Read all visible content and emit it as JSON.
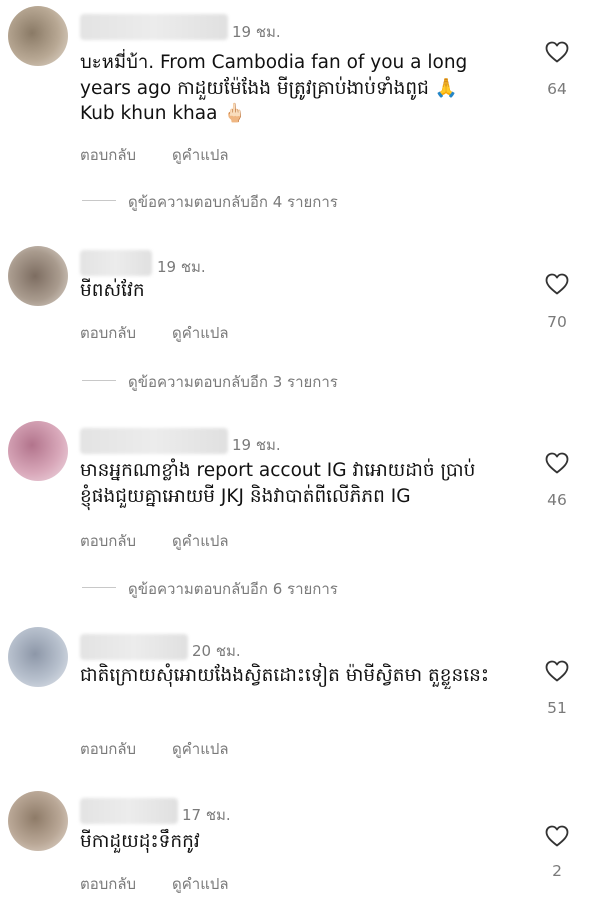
{
  "comments": [
    {
      "time": "19 ชม.",
      "text": "บะหมี่บ้า. From Cambodia fan of you a long years ago កាដួយម៉ែងែង មីត្រូវគ្រាប់ងាប់ទាំងពូជ 🙏\nKub khun khaa 🖕🏻",
      "reply_label": "ตอบกลับ",
      "translate_label": "ดูคำแปล",
      "likes": "64",
      "more_replies": "ดูข้อความตอบกลับอีก 4 รายการ"
    },
    {
      "time": "19 ชม.",
      "text": "មីពស់វែក",
      "reply_label": "ตอบกลับ",
      "translate_label": "ดูคำแปล",
      "likes": "70",
      "more_replies": "ดูข้อความตอบกลับอีก 3 รายการ"
    },
    {
      "time": "19 ชม.",
      "text": "មានអ្នកណាខ្លាំង report accout IG វាអោយដាច់ ប្រាប់ខ្ញុំផងជួយគ្នាអោយមី JKJ និងវាបាត់ពីលើភិភព IG",
      "reply_label": "ตอบกลับ",
      "translate_label": "ดูคำแปล",
      "likes": "46",
      "more_replies": "ดูข้อความตอบกลับอีก 6 รายการ"
    },
    {
      "time": "20 ชม.",
      "text": "ជាតិក្រោយសុំអោយងែងស្វិតដោះទៀត ម៉ាមីស្វិតមា តួខ្លួននេះ",
      "reply_label": "ตอบกลับ",
      "translate_label": "ดูคำแปล",
      "likes": "51"
    },
    {
      "time": "17 ชม.",
      "text": "មីកាដួយដុះទឹកកូវ",
      "reply_label": "ตอบกลับ",
      "translate_label": "ดูคำแปล",
      "likes": "2"
    }
  ],
  "icons": {
    "like": "heart-outline-icon"
  }
}
